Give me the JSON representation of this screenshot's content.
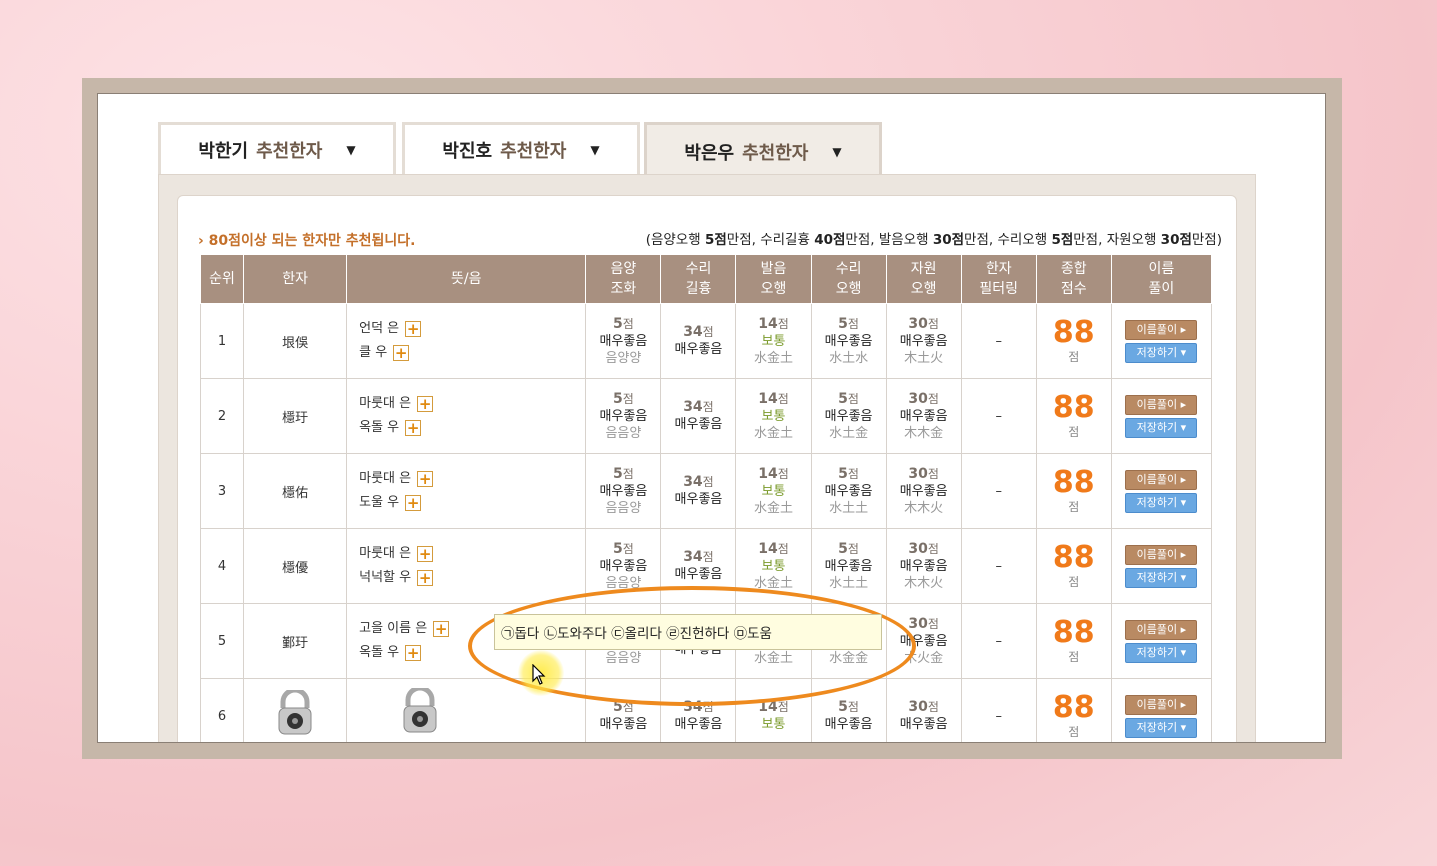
{
  "tabs": [
    {
      "name": "박한기",
      "suffix": "추천한자"
    },
    {
      "name": "박진호",
      "suffix": "추천한자"
    },
    {
      "name": "박은우",
      "suffix": "추천한자"
    }
  ],
  "notice": "› 80점이상 되는 한자만 추천됩니다.",
  "score_info": {
    "open": "(음양오행 ",
    "a": "5점",
    "a_t": "만점, 수리길흉 ",
    "b": "40점",
    "b_t": "만점, 발음오행 ",
    "c": "30점",
    "c_t": "만점, 수리오행 ",
    "d": "5점",
    "d_t": "만점, 자원오행 ",
    "e": "30점",
    "e_t": "만점)"
  },
  "headers": {
    "rank": "순위",
    "hanja": "한자",
    "meaning": "뜻/음",
    "yy1": "음양",
    "yy2": "조화",
    "sr1": "수리",
    "sr2": "길흉",
    "po1": "발음",
    "po2": "오행",
    "so1": "수리",
    "so2": "오행",
    "jw1": "자원",
    "jw2": "오행",
    "hf1": "한자",
    "hf2": "필터링",
    "tot1": "종합",
    "tot2": "점수",
    "nm1": "이름",
    "nm2": "풀이"
  },
  "rows": [
    {
      "rank": "1",
      "hanja": "垠俁",
      "m1": "언덕 은",
      "m2": "클 우",
      "yy": "5",
      "yyg": "매우좋음",
      "yys": "음양양",
      "sr": "34",
      "srg": "매우좋음",
      "po": "14",
      "pog": "보통",
      "pos": "水金土",
      "so": "5",
      "sog": "매우좋음",
      "sos": "水土水",
      "jw": "30",
      "jwg": "매우좋음",
      "jws": "木土火",
      "hf": "–",
      "tot": "88",
      "unit": "점"
    },
    {
      "rank": "2",
      "hanja": "檼玗",
      "m1": "마룻대 은",
      "m2": "옥돌 우",
      "yy": "5",
      "yyg": "매우좋음",
      "yys": "음음양",
      "sr": "34",
      "srg": "매우좋음",
      "po": "14",
      "pog": "보통",
      "pos": "水金土",
      "so": "5",
      "sog": "매우좋음",
      "sos": "水土金",
      "jw": "30",
      "jwg": "매우좋음",
      "jws": "木木金",
      "hf": "–",
      "tot": "88",
      "unit": "점"
    },
    {
      "rank": "3",
      "hanja": "檼佑",
      "m1": "마룻대 은",
      "m2": "도울 우",
      "yy": "5",
      "yyg": "매우좋음",
      "yys": "음음양",
      "sr": "34",
      "srg": "매우좋음",
      "po": "14",
      "pog": "보통",
      "pos": "水金土",
      "so": "5",
      "sog": "매우좋음",
      "sos": "水土土",
      "jw": "30",
      "jwg": "매우좋음",
      "jws": "木木火",
      "hf": "–",
      "tot": "88",
      "unit": "점"
    },
    {
      "rank": "4",
      "hanja": "檼優",
      "m1": "마룻대 은",
      "m2": "넉넉할 우",
      "yy": "5",
      "yyg": "매우좋음",
      "yys": "음음양",
      "sr": "34",
      "srg": "매우좋음",
      "po": "14",
      "pog": "보통",
      "pos": "水金土",
      "so": "5",
      "sog": "매우좋음",
      "sos": "水土土",
      "jw": "30",
      "jwg": "매우좋음",
      "jws": "木木火",
      "hf": "–",
      "tot": "88",
      "unit": "점"
    },
    {
      "rank": "5",
      "hanja": "鄞玗",
      "m1": "고을 이름 은",
      "m2": "옥돌 우",
      "yy": "5",
      "yyg": "매우좋음",
      "yys": "음음양",
      "sr": "34",
      "srg": "매우좋음",
      "po": "14",
      "pog": "보통",
      "pos": "水金土",
      "so": "5",
      "sog": "매우좋음",
      "sos": "水金金",
      "jw": "30",
      "jwg": "매우좋음",
      "jws": "木火金",
      "hf": "–",
      "tot": "88",
      "unit": "점"
    },
    {
      "rank": "6",
      "hanja": "",
      "m1": "",
      "m2": "",
      "yy": "5",
      "yyg": "매우좋음",
      "yys": "",
      "sr": "34",
      "srg": "매우좋음",
      "po": "14",
      "pog": "보통",
      "pos": "",
      "so": "5",
      "sog": "매우좋음",
      "sos": "",
      "jw": "30",
      "jwg": "매우좋음",
      "jws": "",
      "hf": "–",
      "tot": "88",
      "unit": "점"
    }
  ],
  "unit_jeom": "점",
  "buttons": {
    "interpret": "이름풀이 ▸",
    "save": "저장하기 ▾"
  },
  "tooltip": "㉠돕다 ㉡도와주다 ㉢올리다 ㉣진헌하다 ㉤도움",
  "colors": {
    "header_bg": "#a89080",
    "score": "#f07a1a",
    "highlight": "#ee8a1e"
  }
}
